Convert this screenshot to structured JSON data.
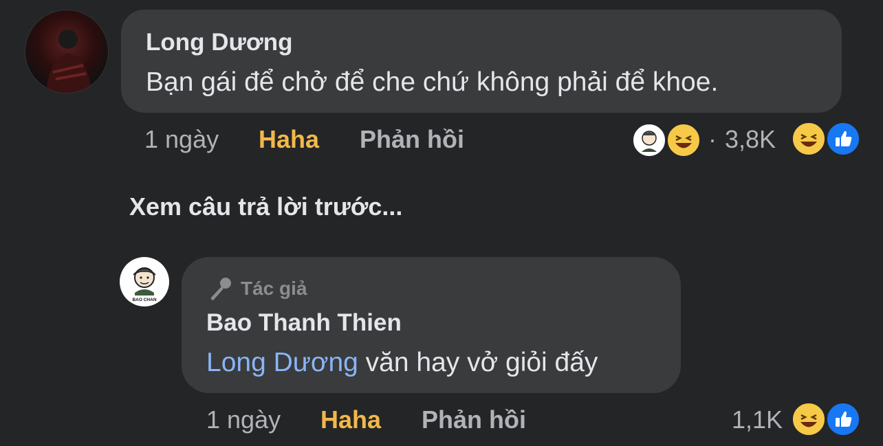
{
  "comment": {
    "author": "Long Dương",
    "text": "Bạn gái để chở để che chứ không phải để khoe.",
    "time": "1 ngày",
    "reaction_label": "Haha",
    "reply_label": "Phản hồi",
    "reaction_count": "3,8K",
    "reactions": [
      "author-avatar",
      "haha-emoji"
    ],
    "top_reactions": [
      "haha-emoji",
      "like-icon"
    ]
  },
  "see_previous": "Xem câu trả lời trước...",
  "reply": {
    "badge_icon": "microphone-icon",
    "badge_label": "Tác giả",
    "author": "Bao Thanh Thien",
    "mention": "Long Dương",
    "text": " văn hay vở giỏi đấy",
    "time": "1 ngày",
    "reaction_label": "Haha",
    "reply_label": "Phản hồi",
    "reaction_count": "1,1K",
    "top_reactions": [
      "haha-emoji",
      "like-icon"
    ]
  },
  "colors": {
    "background": "#242526",
    "bubble": "#3a3b3c",
    "haha_accent": "#f2b84b",
    "mention": "#8ab4f8",
    "like_blue": "#1877f2"
  }
}
